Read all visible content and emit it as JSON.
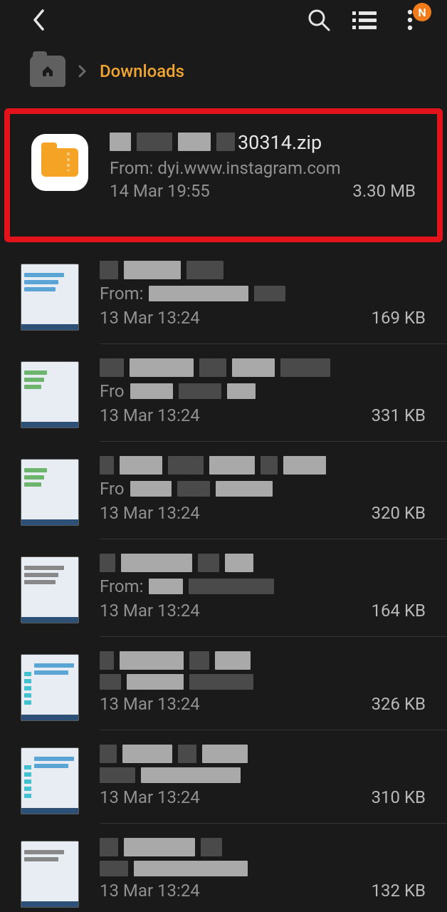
{
  "header": {
    "badge_letter": "N"
  },
  "breadcrumb": {
    "current": "Downloads"
  },
  "files": [
    {
      "title_suffix": "30314.zip",
      "from_label": "From: dyi.www.instagram.com",
      "date": "14 Mar 19:55",
      "size": "3.30 MB"
    },
    {
      "from_prefix": "From:",
      "date": "13 Mar 13:24",
      "size": "169 KB"
    },
    {
      "from_prefix": "Fro",
      "date": "13 Mar 13:24",
      "size": "331 KB"
    },
    {
      "from_prefix": "Fro",
      "date": "13 Mar 13:24",
      "size": "320 KB"
    },
    {
      "from_prefix": "From:",
      "date": "13 Mar 13:24",
      "size": "164 KB"
    },
    {
      "from_prefix": "",
      "date": "13 Mar 13:24",
      "size": "326 KB"
    },
    {
      "from_prefix": "",
      "date": "13 Mar 13:24",
      "size": "310 KB"
    },
    {
      "from_prefix": "",
      "date": "13 Mar 13:24",
      "size": "132 KB"
    }
  ]
}
